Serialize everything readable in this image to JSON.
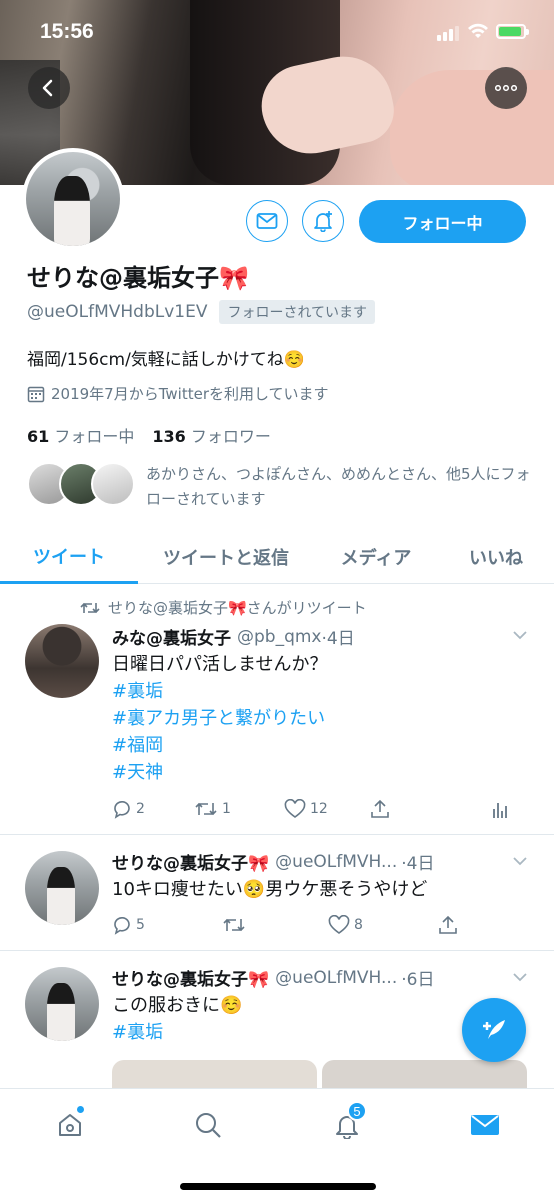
{
  "status_bar": {
    "time": "15:56"
  },
  "profile": {
    "name": "せりな@裏垢女子🎀",
    "handle": "@ueOLfMVHdbLv1EV",
    "follows_you": "フォローされています",
    "bio": "福岡/156cm/気軽に話しかけてね☺️",
    "joined": "2019年7月からTwitterを利用しています",
    "following_count": "61",
    "following_label": "フォロー中",
    "followers_count": "136",
    "followers_label": "フォロワー",
    "followed_by_text": "あかりさん、つよぽんさん、めめんとさん、他5人にフォローされています",
    "follow_button": "フォロー中"
  },
  "tabs": [
    {
      "label": "ツイート"
    },
    {
      "label": "ツイートと返信"
    },
    {
      "label": "メディア"
    },
    {
      "label": "いいね"
    }
  ],
  "tweets": [
    {
      "retweeted_by": "せりな@裏垢女子🎀さんがリツイート",
      "name": "みな@裏垢女子",
      "handle": "@pb_qmx",
      "date": "·4日",
      "text": "日曜日パパ活しませんか？",
      "tags": [
        "#裏垢",
        "#裏アカ男子と繋がりたい",
        "#福岡",
        "#天神"
      ],
      "replies": "2",
      "retweets": "1",
      "likes": "12"
    },
    {
      "name": "せりな@裏垢女子🎀",
      "handle": "@ueOLfMVH...",
      "date": "·4日",
      "text": "10キロ痩せたい🥺男ウケ悪そうやけど",
      "replies": "5",
      "retweets": "",
      "likes": "8"
    },
    {
      "name": "せりな@裏垢女子🎀",
      "handle": "@ueOLfMVH...",
      "date": "·6日",
      "text": "この服おきに☺️",
      "tags": [
        "#裏垢"
      ]
    }
  ],
  "nav": {
    "notifications_badge": "5"
  },
  "colors": {
    "accent": "#1da1f2",
    "secondary_text": "#657786",
    "divider": "#e1e8ed"
  }
}
